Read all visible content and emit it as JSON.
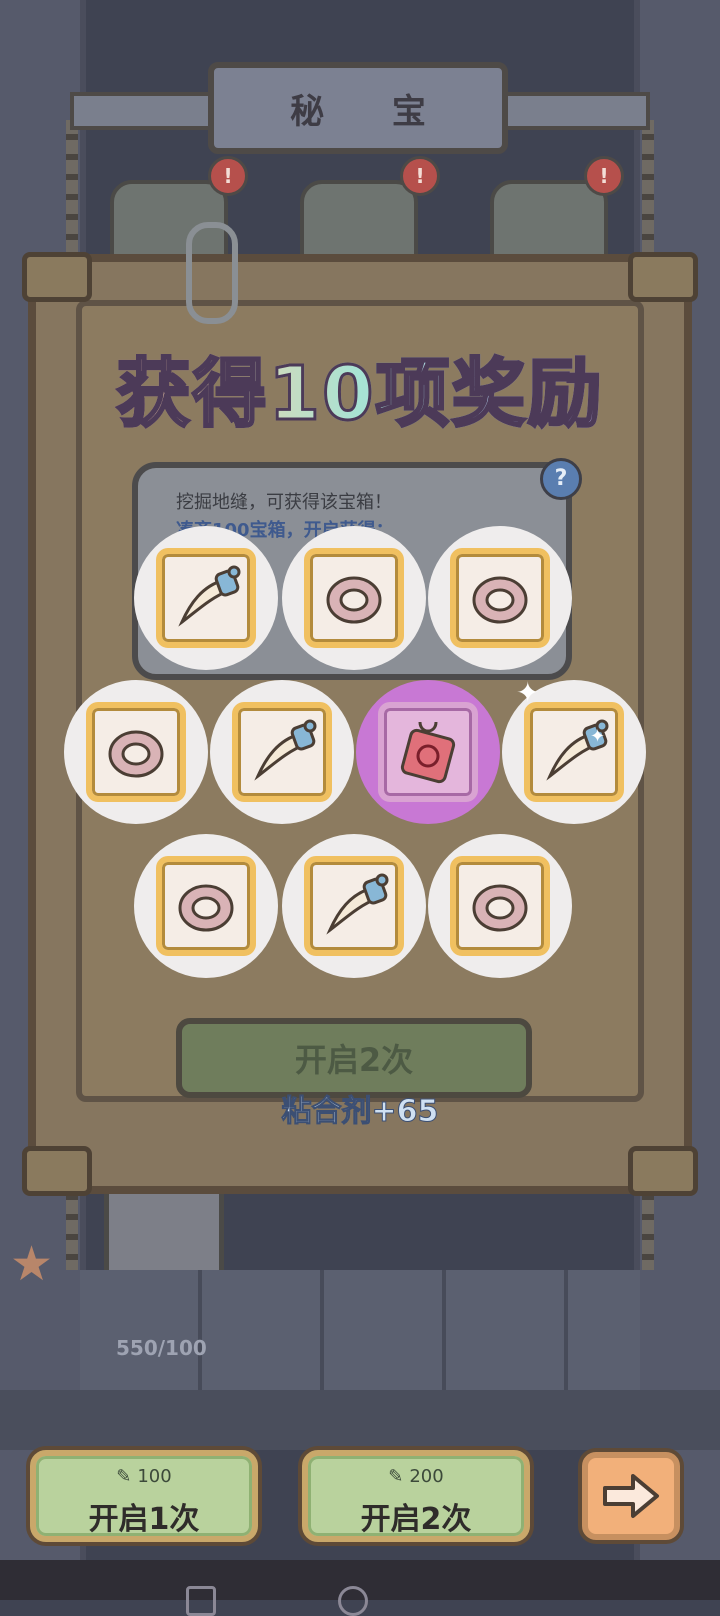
{
  "screen": {
    "title": "秘 宝",
    "alert_mark": "!",
    "progress": "550/100",
    "reward_headline": "获得10项奖励"
  },
  "chest_info": {
    "line1": "挖掘地缝，可获得该宝箱！",
    "line2": "凑齐100宝箱，开启获得：",
    "help": "?"
  },
  "open_panel": {
    "button_label": "开启2次",
    "reward_text": "粘合剂+65"
  },
  "rewards": [
    {
      "item": "fang-charm-icon",
      "rarity": "common"
    },
    {
      "item": "ring-icon",
      "rarity": "common"
    },
    {
      "item": "ring-icon",
      "rarity": "common"
    },
    {
      "item": "ring-icon",
      "rarity": "common"
    },
    {
      "item": "fang-charm-icon",
      "rarity": "common"
    },
    {
      "item": "red-talisman-icon",
      "rarity": "rare"
    },
    {
      "item": "fang-charm-icon",
      "rarity": "common"
    },
    {
      "item": "ring-icon",
      "rarity": "common"
    },
    {
      "item": "fang-charm-icon",
      "rarity": "common"
    },
    {
      "item": "ring-icon",
      "rarity": "common"
    }
  ],
  "bottom_bar": {
    "open_once": {
      "cost": "100",
      "label": "开启1次"
    },
    "open_twice": {
      "cost": "200",
      "label": "开启2次"
    },
    "next_icon": "arrow-right-icon"
  },
  "colors": {
    "tile_border": "#f0c060",
    "rare_circle": "#c878d4",
    "button_green": "#b9d29d",
    "next_orange": "#f2b07a"
  }
}
